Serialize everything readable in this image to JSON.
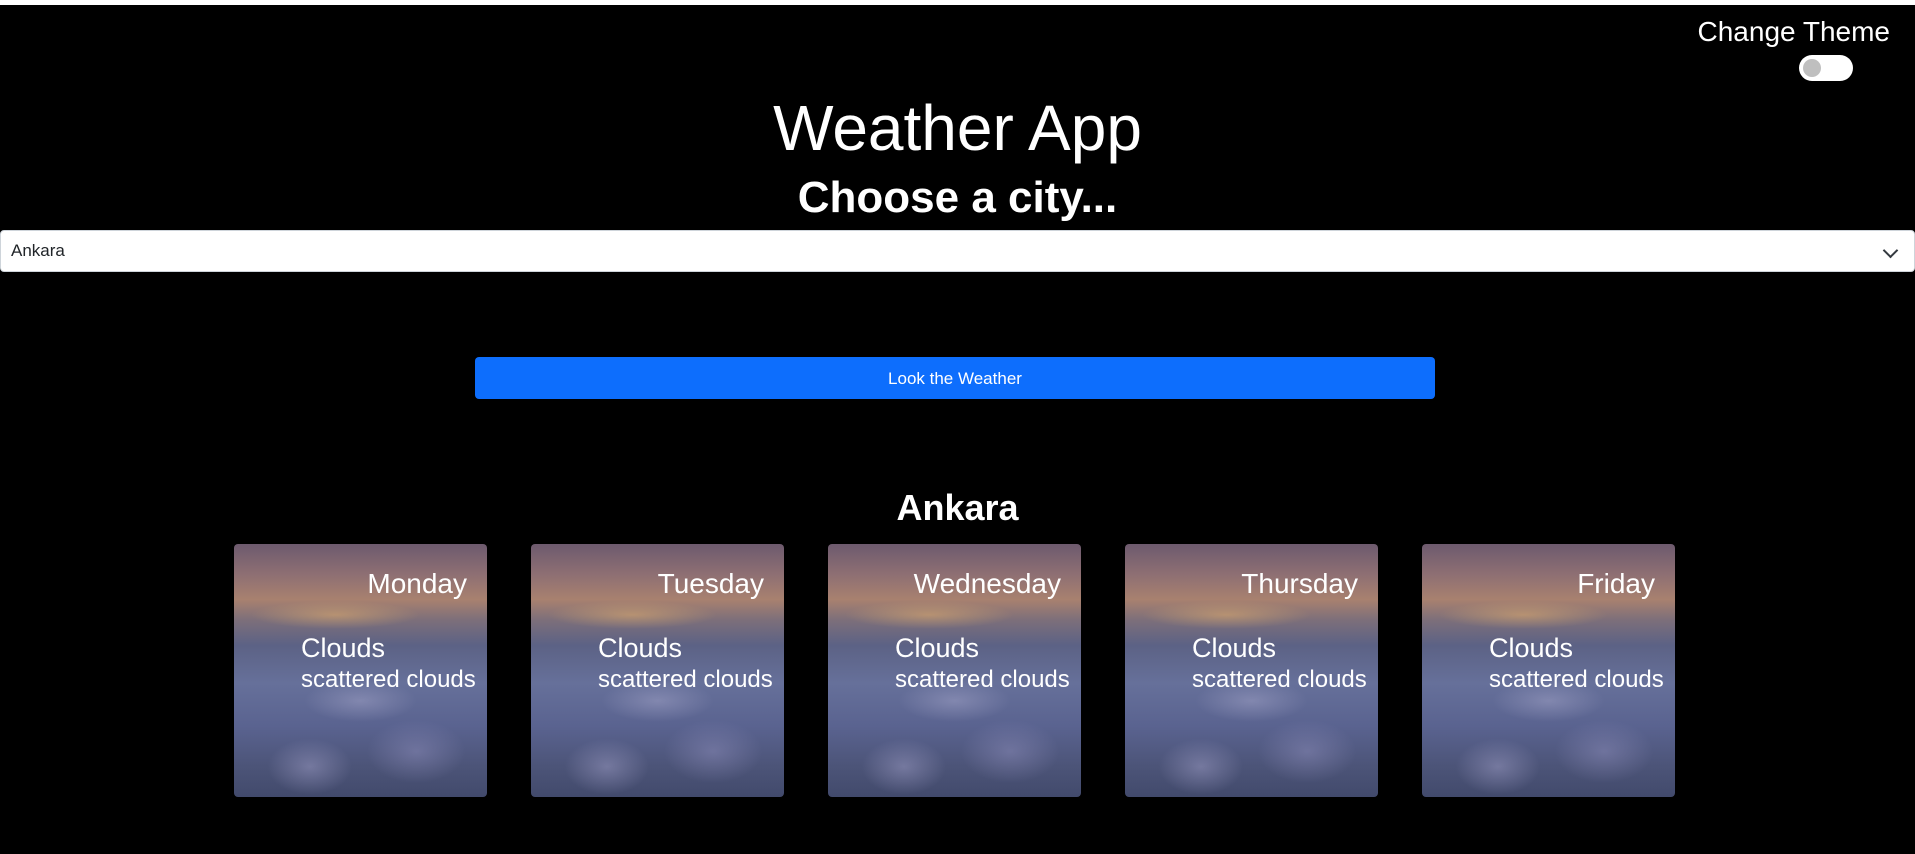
{
  "theme": {
    "label": "Change Theme",
    "toggle_on": false
  },
  "header": {
    "title": "Weather App",
    "subtitle": "Choose a city..."
  },
  "city_select": {
    "selected": "Ankara"
  },
  "look_button": {
    "label": "Look the Weather"
  },
  "result": {
    "city": "Ankara",
    "days": [
      {
        "day": "Monday",
        "main": "Clouds",
        "description": "scattered clouds"
      },
      {
        "day": "Tuesday",
        "main": "Clouds",
        "description": "scattered clouds"
      },
      {
        "day": "Wednesday",
        "main": "Clouds",
        "description": "scattered clouds"
      },
      {
        "day": "Thursday",
        "main": "Clouds",
        "description": "scattered clouds"
      },
      {
        "day": "Friday",
        "main": "Clouds",
        "description": "scattered clouds"
      }
    ]
  },
  "colors": {
    "background": "#000000",
    "primary_button": "#0d6efd",
    "text": "#ffffff"
  }
}
